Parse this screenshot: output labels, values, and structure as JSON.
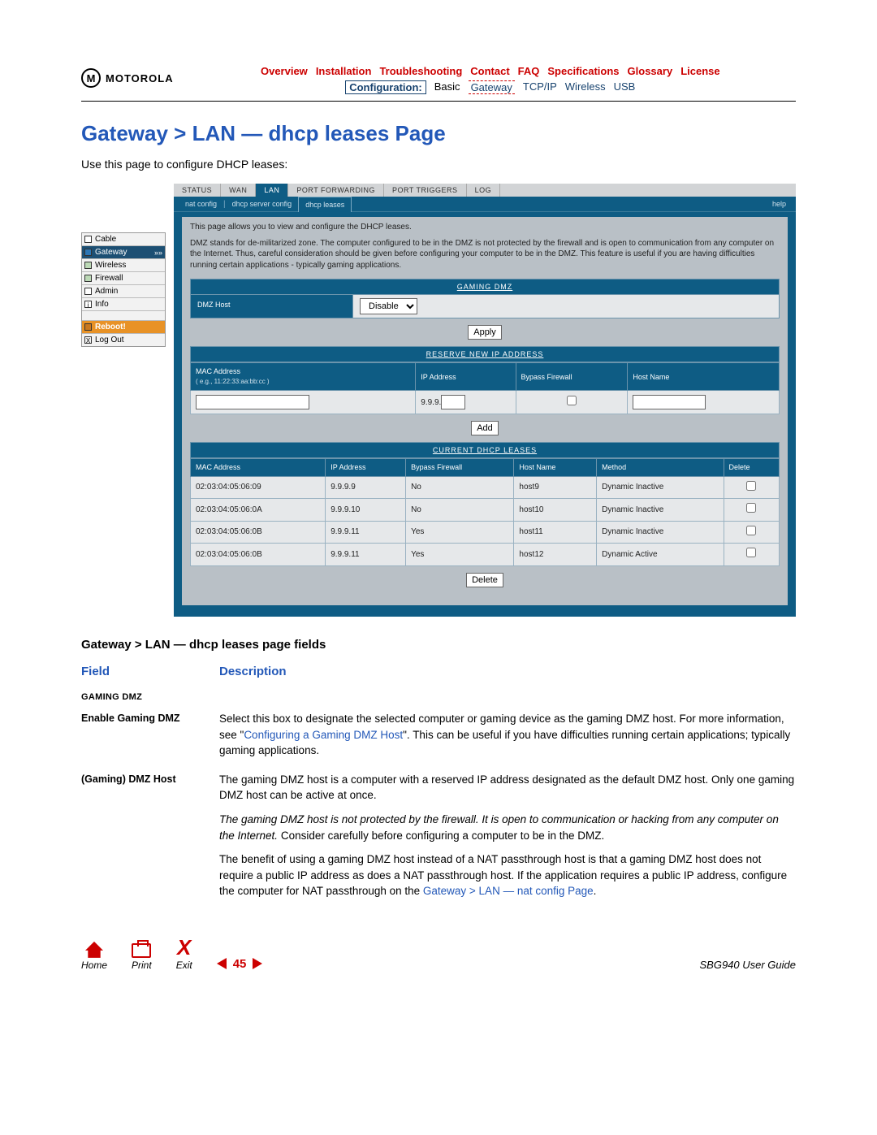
{
  "brand": "MOTOROLA",
  "topnav": [
    "Overview",
    "Installation",
    "Troubleshooting",
    "Contact",
    "FAQ",
    "Specifications",
    "Glossary",
    "License"
  ],
  "subnav": {
    "label": "Configuration:",
    "items": [
      "Basic",
      "Gateway",
      "TCP/IP",
      "Wireless",
      "USB"
    ],
    "active": "Gateway"
  },
  "page_title": "Gateway > LAN — dhcp leases Page",
  "intro": "Use this page to configure DHCP leases:",
  "sidenav": {
    "items": [
      "Cable",
      "Gateway",
      "Wireless",
      "Firewall",
      "Admin",
      "Info"
    ],
    "active": "Gateway",
    "reboot": "Reboot!",
    "logout": "Log Out"
  },
  "panel": {
    "tabs": [
      "STATUS",
      "WAN",
      "LAN",
      "PORT FORWARDING",
      "PORT TRIGGERS",
      "LOG"
    ],
    "tab_active": "LAN",
    "subtabs": [
      "nat config",
      "dhcp server config",
      "dhcp leases"
    ],
    "subtab_active": "dhcp leases",
    "help": "help",
    "blurb1": "This page allows you to view and configure the DHCP leases.",
    "blurb2": "DMZ stands for de-militarized zone. The computer configured to be in the DMZ is not protected by the firewall and is open to communication from any computer on the Internet. Thus, careful consideration should be given before configuring your computer to be in the DMZ. This feature is useful if you are having difficulties running certain applications - typically gaming applications.",
    "gaming_dmz": {
      "title": "GAMING DMZ",
      "row_label": "DMZ Host",
      "select": "Disable",
      "apply": "Apply"
    },
    "reserve": {
      "title": "RESERVE NEW IP ADDRESS",
      "headers": [
        "MAC Address",
        "IP Address",
        "Bypass Firewall",
        "Host Name"
      ],
      "mac_hint": "( e.g., 11:22:33:aa:bb:cc )",
      "ip_prefix": "9.9.9.",
      "add": "Add"
    },
    "current": {
      "title": "CURRENT DHCP LEASES",
      "headers": [
        "MAC Address",
        "IP Address",
        "Bypass Firewall",
        "Host Name",
        "Method",
        "Delete"
      ],
      "rows": [
        {
          "mac": "02:03:04:05:06:09",
          "ip": "9.9.9.9",
          "bypass": "No",
          "host": "host9",
          "method": "Dynamic Inactive"
        },
        {
          "mac": "02:03:04:05:06:0A",
          "ip": "9.9.9.10",
          "bypass": "No",
          "host": "host10",
          "method": "Dynamic Inactive"
        },
        {
          "mac": "02:03:04:05:06:0B",
          "ip": "9.9.9.11",
          "bypass": "Yes",
          "host": "host11",
          "method": "Dynamic Inactive"
        },
        {
          "mac": "02:03:04:05:06:0B",
          "ip": "9.9.9.11",
          "bypass": "Yes",
          "host": "host12",
          "method": "Dynamic Active"
        }
      ],
      "delete": "Delete"
    }
  },
  "fields_heading": "Gateway > LAN — dhcp leases page fields",
  "ft": {
    "col1": "Field",
    "col2": "Description",
    "sec1": "GAMING DMZ",
    "r1_label": "Enable Gaming DMZ",
    "r1_a": "Select this box to designate the selected computer or gaming device as the gaming DMZ host. For more information, see \"",
    "r1_link": "Configuring a Gaming DMZ Host",
    "r1_b": "\". This can be useful if you have difficulties running certain applications; typically gaming applications.",
    "r2_label": "(Gaming) DMZ Host",
    "r2_a": "The gaming DMZ host is a computer with a reserved IP address designated as the default DMZ host. Only one gaming DMZ host can be active at once.",
    "r2_b": "The gaming DMZ host is not protected by the firewall. It is open to communication or hacking from any computer on the Internet.",
    "r2_c": " Consider carefully before configuring a computer to be in the DMZ.",
    "r2_d": "The benefit of using a gaming DMZ host instead of a NAT passthrough host is that a gaming DMZ host does not require a public IP address as does a NAT passthrough host. If the application requires a public IP address, configure the computer for NAT passthrough on the ",
    "r2_link": "Gateway > LAN — nat config Page",
    "r2_e": "."
  },
  "footer": {
    "home": "Home",
    "print": "Print",
    "exit": "Exit",
    "page": "45",
    "guide": "SBG940 User Guide"
  }
}
